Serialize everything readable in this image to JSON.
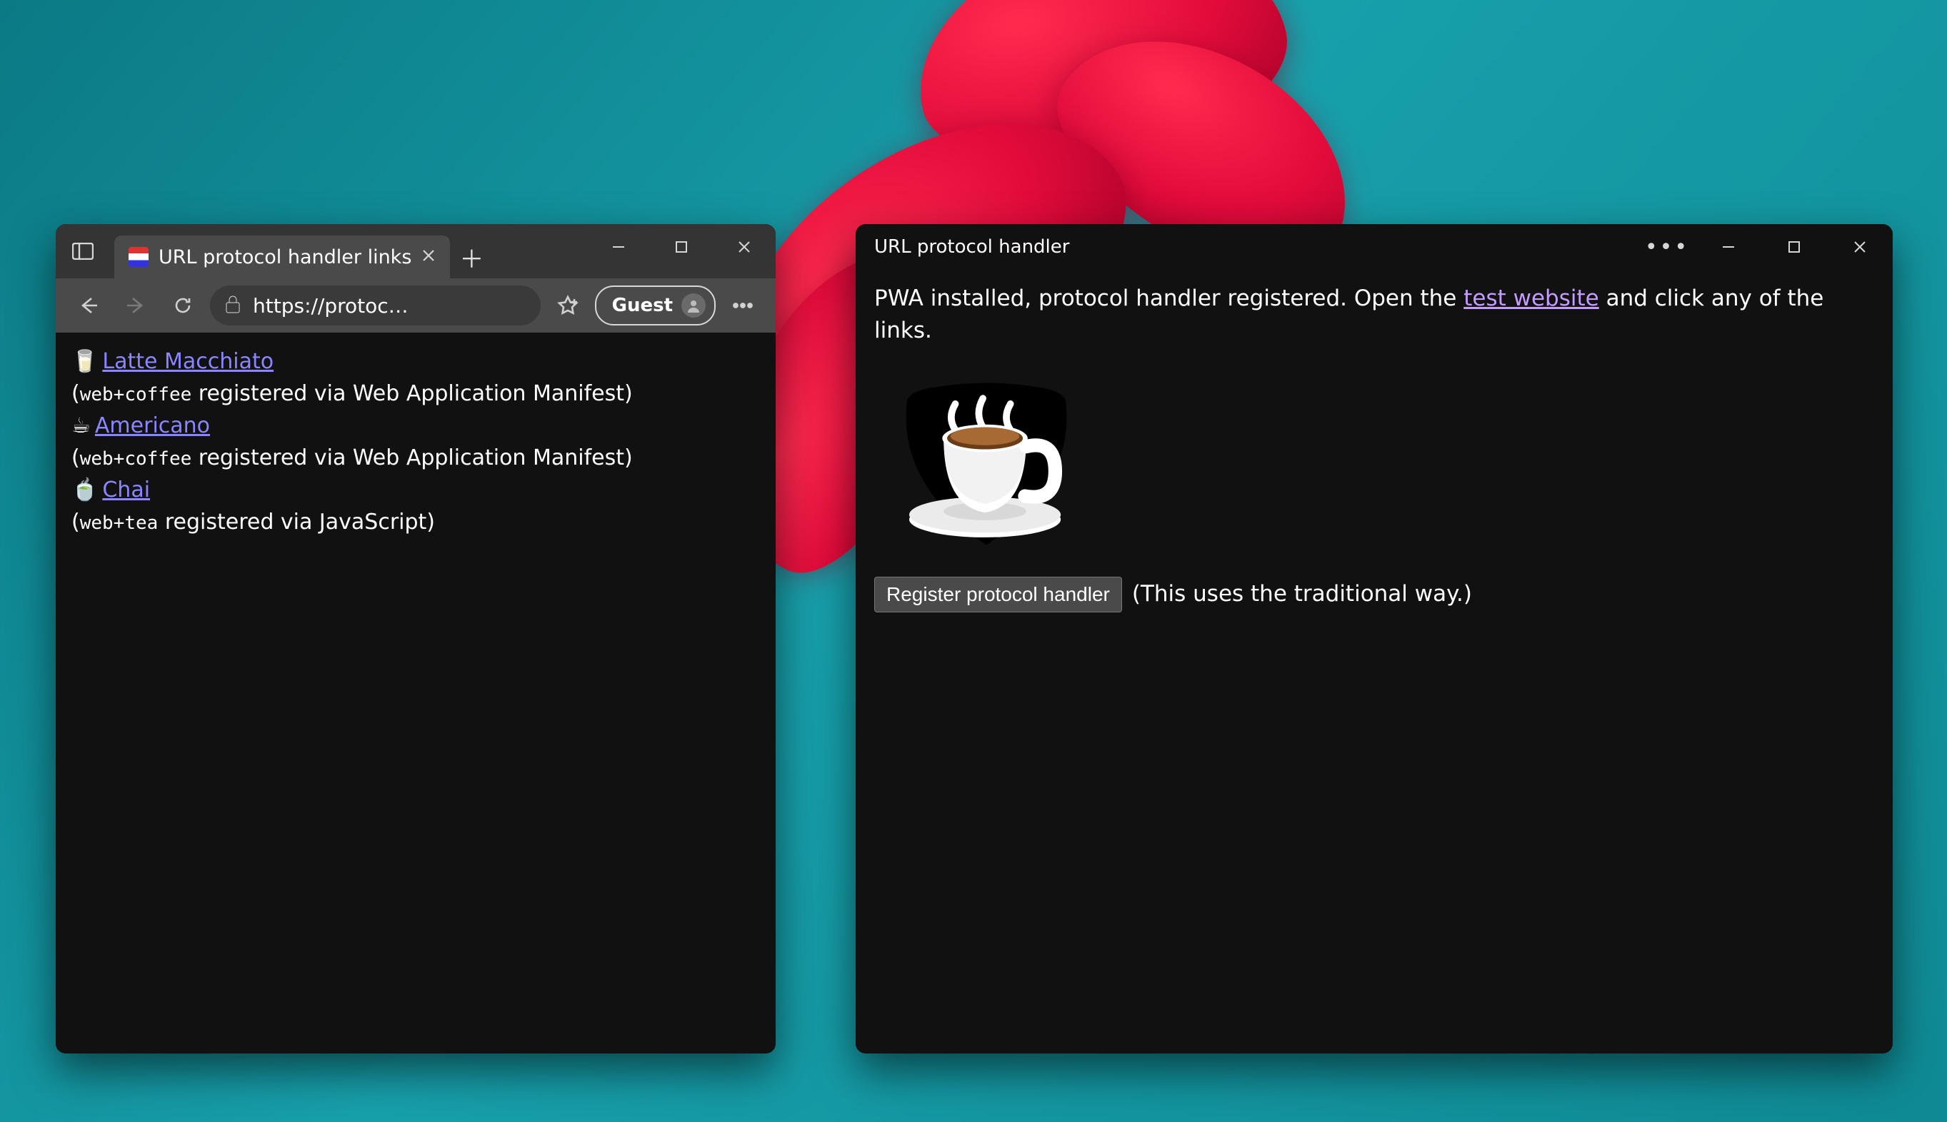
{
  "browser": {
    "tab_title": "URL protocol handler links",
    "url_display": "https://protoc…",
    "guest_label": "Guest",
    "entries": [
      {
        "emoji": "🥛",
        "link": "  Latte Macchiato",
        "protocol": "web+coffee",
        "note": " registered via Web Application Manifest)"
      },
      {
        "emoji": "☕",
        "link": "  Americano",
        "protocol": "web+coffee",
        "note": " registered via Web Application Manifest)"
      },
      {
        "emoji": "🍵",
        "link": "  Chai",
        "protocol": "web+tea",
        "note": " registered via JavaScript)"
      }
    ]
  },
  "pwa": {
    "title": "URL protocol handler",
    "message_before": "PWA installed, protocol handler registered. Open the ",
    "message_link": "test website",
    "message_after": " and click any of the links.",
    "button_label": "Register protocol handler",
    "button_note": "(This uses the traditional way.)"
  }
}
